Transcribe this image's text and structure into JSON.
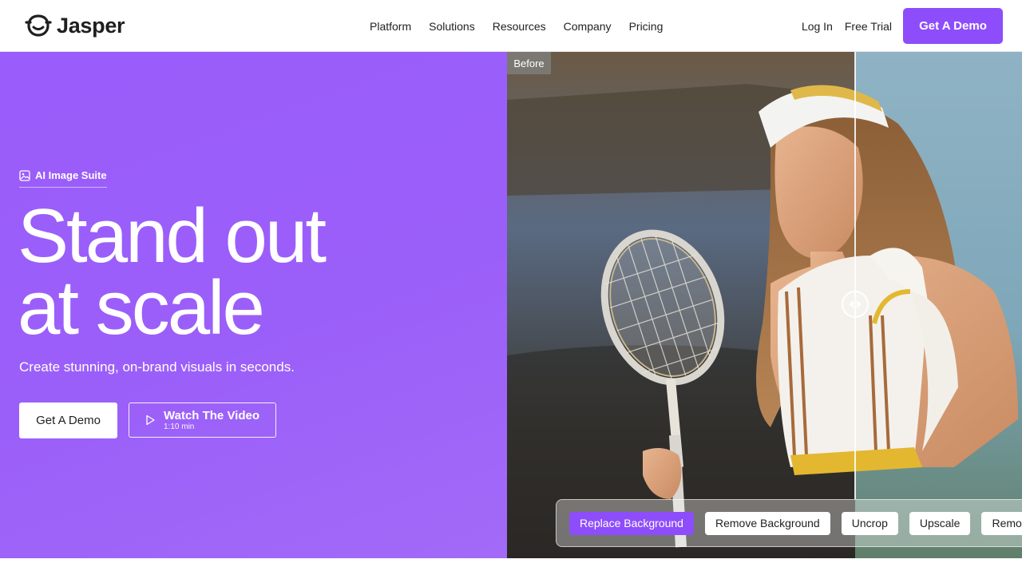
{
  "brand": {
    "name": "Jasper",
    "accent": "#8d4dfb",
    "hero_bg": "#9b5ff9"
  },
  "nav": {
    "items": [
      {
        "label": "Platform"
      },
      {
        "label": "Solutions"
      },
      {
        "label": "Resources"
      },
      {
        "label": "Company"
      },
      {
        "label": "Pricing"
      }
    ],
    "login": "Log In",
    "free_trial": "Free Trial",
    "demo": "Get A Demo"
  },
  "hero": {
    "eyebrow": "AI Image Suite",
    "eyebrow_icon": "image-icon",
    "title_line1": "Stand out",
    "title_line2": "at scale",
    "subtitle": "Create stunning, on-brand visuals in seconds.",
    "cta_primary": "Get A Demo",
    "cta_video": "Watch The Video",
    "cta_video_duration": "1:10 min",
    "cta_video_icon": "play-icon"
  },
  "comparer": {
    "before_label": "Before",
    "handle_icon": "left-right-arrows-icon",
    "tools": [
      {
        "label": "Replace Background",
        "active": true
      },
      {
        "label": "Remove Background",
        "active": false
      },
      {
        "label": "Uncrop",
        "active": false
      },
      {
        "label": "Upscale",
        "active": false
      },
      {
        "label": "Remove",
        "active": false
      }
    ]
  }
}
